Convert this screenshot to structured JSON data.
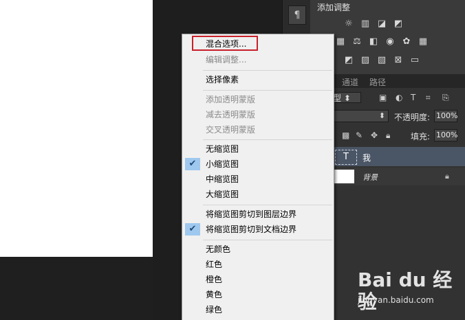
{
  "adjustments": {
    "title": "添加调整",
    "row1_icons": [
      "brightness-icon",
      "levels-icon",
      "curves-icon",
      "exposure-icon"
    ],
    "row2_icons": [
      "vibrance-icon",
      "balance-icon",
      "bw-icon",
      "photo-filter-icon",
      "channel-mixer-icon",
      "color-lookup-icon"
    ],
    "row3_icons": [
      "invert-icon",
      "posterize-icon",
      "threshold-icon",
      "selective-color-icon",
      "gradient-map-icon"
    ]
  },
  "layers": {
    "tabs": [
      "通道",
      "路径"
    ],
    "filter_kind": "型",
    "opacity_label": "不透明度:",
    "opacity_value": "100%",
    "fill_label": "填充:",
    "fill_value": "100%",
    "layer_text_name": "我",
    "layer_text_thumb": "T",
    "layer_bg_name": "背景"
  },
  "tool_strip": {
    "paragraph_glyph": "¶"
  },
  "context_menu": {
    "items": [
      {
        "label": "混合选项...",
        "disabled": false,
        "checked": false
      },
      {
        "label": "编辑调整...",
        "disabled": true,
        "checked": false
      },
      {
        "label": "选择像素",
        "disabled": false,
        "checked": false
      },
      {
        "label": "添加透明蒙版",
        "disabled": true,
        "checked": false
      },
      {
        "label": "减去透明蒙版",
        "disabled": true,
        "checked": false
      },
      {
        "label": "交叉透明蒙版",
        "disabled": true,
        "checked": false
      },
      {
        "label": "无缩览图",
        "disabled": false,
        "checked": false
      },
      {
        "label": "小缩览图",
        "disabled": false,
        "checked": true
      },
      {
        "label": "中缩览图",
        "disabled": false,
        "checked": false
      },
      {
        "label": "大缩览图",
        "disabled": false,
        "checked": false
      },
      {
        "label": "将缩览图剪切到图层边界",
        "disabled": false,
        "checked": false
      },
      {
        "label": "将缩览图剪切到文档边界",
        "disabled": false,
        "checked": true
      },
      {
        "label": "无颜色",
        "disabled": false,
        "checked": false
      },
      {
        "label": "红色",
        "disabled": false,
        "checked": false
      },
      {
        "label": "橙色",
        "disabled": false,
        "checked": false
      },
      {
        "label": "黄色",
        "disabled": false,
        "checked": false
      },
      {
        "label": "绿色",
        "disabled": false,
        "checked": false
      }
    ],
    "check_glyph": "✔"
  },
  "watermark": {
    "logo": "Bai du 经验",
    "url": "jingyan.baidu.com"
  },
  "colors": {
    "highlight": "#c8202a",
    "check_bg": "#9fc8ee",
    "selected_layer": "#4a5566"
  }
}
